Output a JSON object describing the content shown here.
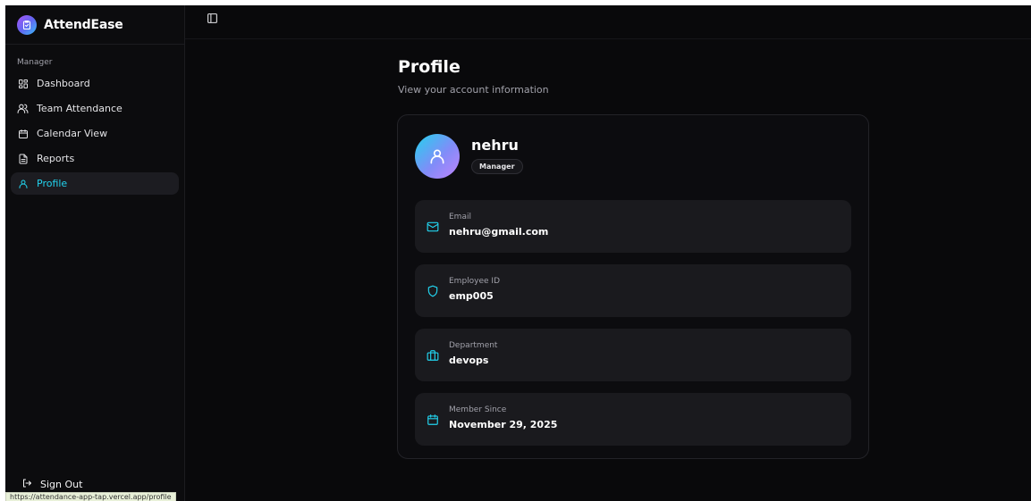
{
  "app": {
    "name": "AttendEase"
  },
  "sidebar": {
    "section_label": "Manager",
    "items": [
      {
        "label": "Dashboard",
        "icon": "dashboard-icon"
      },
      {
        "label": "Team Attendance",
        "icon": "users-icon"
      },
      {
        "label": "Calendar View",
        "icon": "calendar-icon"
      },
      {
        "label": "Reports",
        "icon": "file-icon"
      },
      {
        "label": "Profile",
        "icon": "user-icon",
        "active": true
      }
    ],
    "signout_label": "Sign Out"
  },
  "status_bar": {
    "url": "https://attendance-app-tap.vercel.app/profile"
  },
  "page": {
    "title": "Profile",
    "subtitle": "View your account information"
  },
  "profile": {
    "name": "nehru",
    "role": "Manager",
    "fields": [
      {
        "label": "Email",
        "value": "nehru@gmail.com",
        "icon": "mail-icon"
      },
      {
        "label": "Employee ID",
        "value": "emp005",
        "icon": "shield-icon"
      },
      {
        "label": "Department",
        "value": "devops",
        "icon": "briefcase-icon"
      },
      {
        "label": "Member Since",
        "value": "November 29, 2025",
        "icon": "calendar-icon"
      }
    ]
  },
  "colors": {
    "accent": "#22d3ee",
    "background": "#09090b",
    "card": "#1a1a1e"
  }
}
